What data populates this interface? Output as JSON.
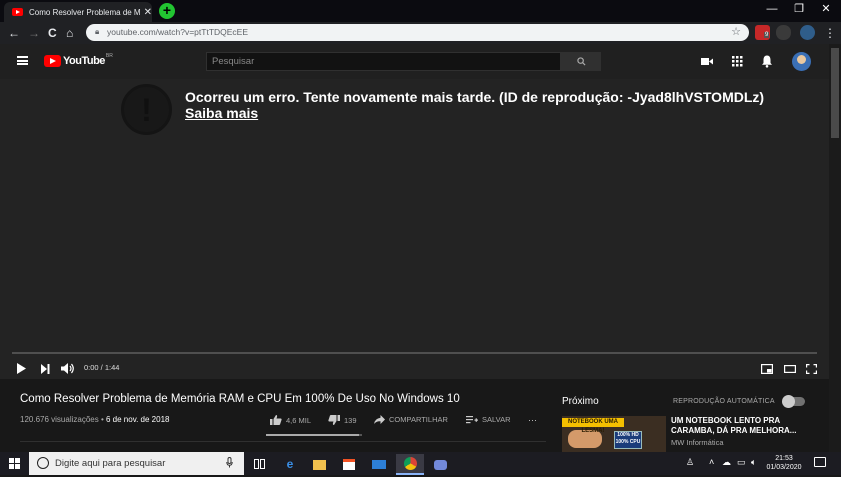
{
  "browser": {
    "tab_title": "Como Resolver Problema de Mem",
    "tab_close": "✕",
    "new_tab": "+",
    "url": "youtube.com/watch?v=ptTtTDQEcEE",
    "window_minimize": "—",
    "window_restore": "❐",
    "window_close": "✕",
    "back": "←",
    "forward": "→",
    "reload": "C",
    "home": "⌂",
    "star": "☆",
    "menu": "⋮",
    "extension_badge": "9"
  },
  "youtube": {
    "logo_text": "YouTube",
    "logo_region": "BR",
    "search_placeholder": "Pesquisar"
  },
  "player": {
    "error_message": "Ocorreu um erro. Tente novamente mais tarde. (ID de reprodução: -Jyad8lhVSTOMDLz)",
    "error_link": "Saiba mais",
    "error_glyph": "!",
    "time": "0:00 / 1:44"
  },
  "video": {
    "title": "Como Resolver Problema de Memória RAM e CPU Em 100% De Uso No Windows 10",
    "views": "120.676 visualizações",
    "separator": "•",
    "date": "6 de nov. de 2018",
    "likes": "4,6 MIL",
    "dislikes": "139",
    "like_ratio": 0.97,
    "share": "COMPARTILHAR",
    "save": "SALVAR",
    "more": "···"
  },
  "sidebar": {
    "next_label": "Próximo",
    "autoplay_label": "REPRODUÇÃO AUTOMÁTICA",
    "next_video": {
      "title": "UM NOTEBOOK LENTO PRA CARAMBA, DÁ PRA MELHORA...",
      "channel": "MW Informática",
      "thumb_banner": "NOTEBOOK UMA LESMA!",
      "thumb_chip": "100% HD 100% CPU"
    }
  },
  "taskbar": {
    "search_placeholder": "Digite aqui para pesquisar",
    "time": "21:53",
    "date": "01/03/2020"
  },
  "colors": {
    "youtube_red": "#ff0000",
    "chrome_new_tab": "#22c531",
    "player_bg": "#232323",
    "page_bg": "#181818"
  }
}
